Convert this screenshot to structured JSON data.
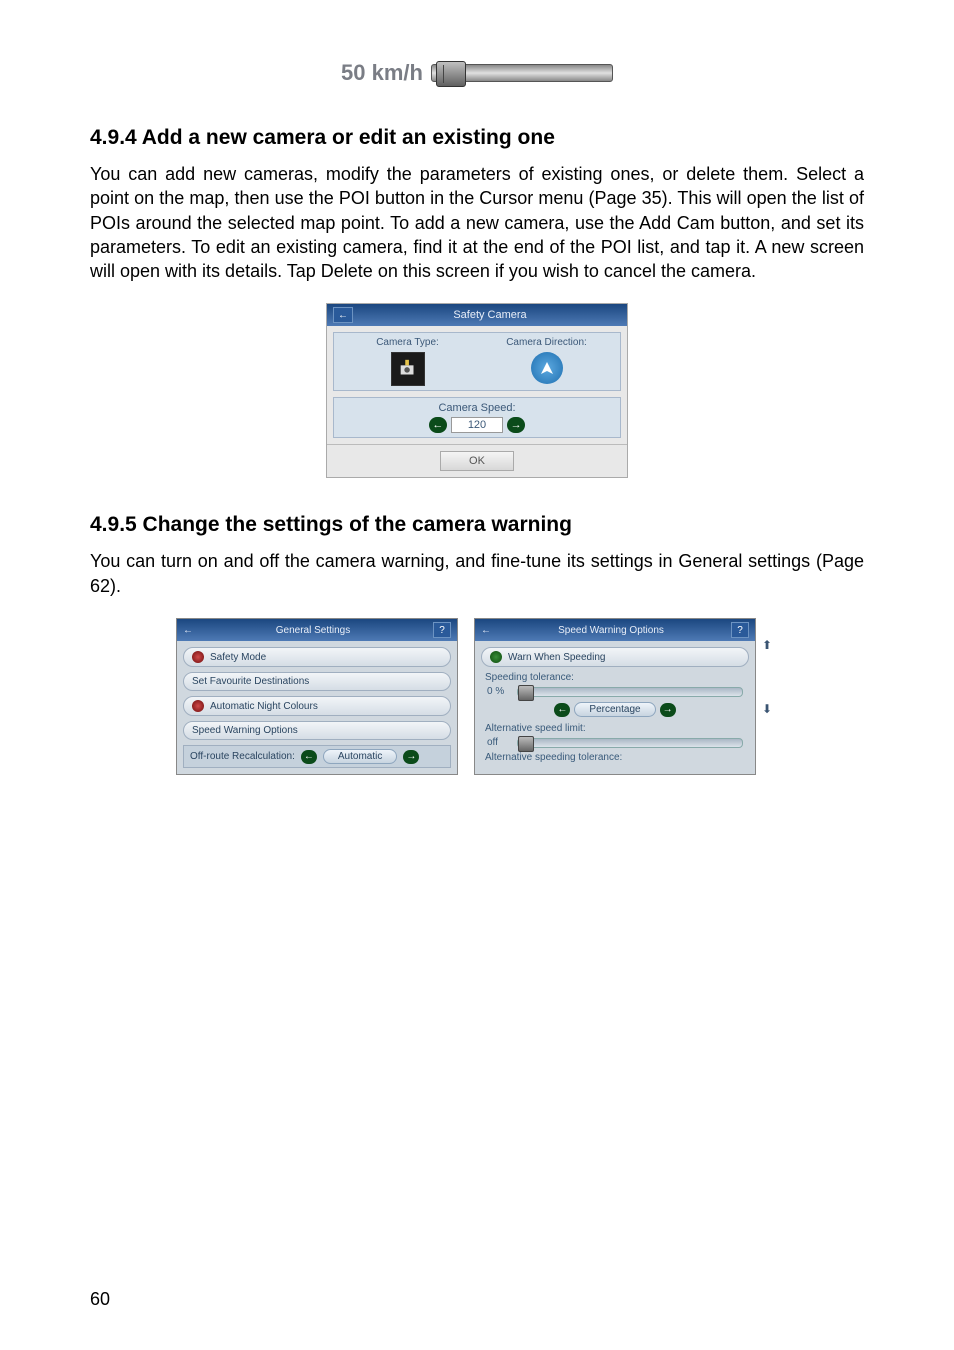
{
  "slider": {
    "label": "50 km/h"
  },
  "section1": {
    "heading": "4.9.4  Add a new camera or edit an existing one",
    "body": "You can add new cameras, modify the parameters of existing ones, or delete them. Select a point on the map, then use the POI button in the Cursor menu (Page 35). This will open the list of POIs around the selected map point. To add a new camera, use the Add Cam button, and set its parameters. To edit an existing camera, find it at the end of the POI list, and tap it. A new screen will open with its details. Tap Delete on this screen if you wish to cancel the camera."
  },
  "safety_panel": {
    "title": "Safety Camera",
    "type_label": "Camera Type:",
    "direction_label": "Camera Direction:",
    "speed_label": "Camera Speed:",
    "speed_value": "120",
    "ok": "OK"
  },
  "section2": {
    "heading": "4.9.5  Change the settings of the camera warning",
    "body": "You can turn on and off the camera warning, and fine-tune its settings in General settings (Page 62)."
  },
  "general_panel": {
    "title": "General Settings",
    "items": {
      "safety_mode": "Safety Mode",
      "set_fav": "Set Favourite Destinations",
      "night": "Automatic Night Colours",
      "speed_warn": "Speed Warning Options"
    },
    "offroute_label": "Off-route Recalculation:",
    "offroute_value": "Automatic"
  },
  "warning_panel": {
    "title": "Speed Warning Options",
    "warn_label": "Warn When Speeding",
    "tol_label": "Speeding tolerance:",
    "tol_value": "0 %",
    "percentage": "Percentage",
    "alt_limit": "Alternative speed limit:",
    "alt_value": "off",
    "alt_tol": "Alternative speeding tolerance:"
  },
  "pagenum": "60"
}
